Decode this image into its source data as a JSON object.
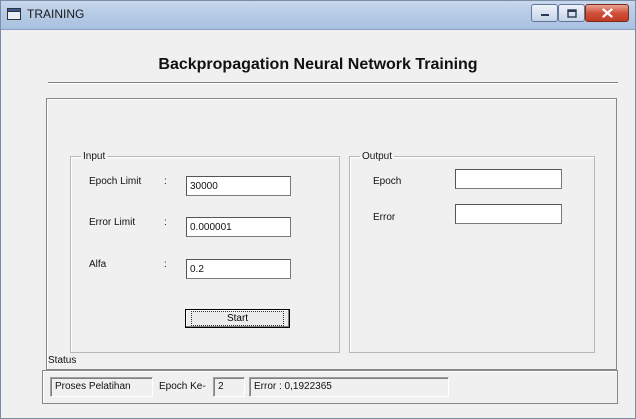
{
  "window": {
    "title": "TRAINING"
  },
  "heading": "Backpropagation Neural Network Training",
  "input_group": {
    "legend": "Input",
    "epoch_limit": {
      "label": "Epoch Limit",
      "colon": ":",
      "value": "30000"
    },
    "error_limit": {
      "label": "Error Limit",
      "colon": ":",
      "value": "0.000001"
    },
    "alfa": {
      "label": "Alfa",
      "colon": ":",
      "value": "0.2"
    },
    "start_label": "Start"
  },
  "output_group": {
    "legend": "Output",
    "epoch": {
      "label": "Epoch",
      "value": ""
    },
    "error": {
      "label": "Error",
      "value": ""
    }
  },
  "status": {
    "label": "Status",
    "process_text": "Proses Pelatihan",
    "epoch_ke_label": "Epoch Ke-",
    "epoch_ke_value": "2",
    "error_text": "Error : 0,1922365"
  },
  "colors": {
    "face": "#f0f0f0",
    "close_button": "#c13a24"
  }
}
